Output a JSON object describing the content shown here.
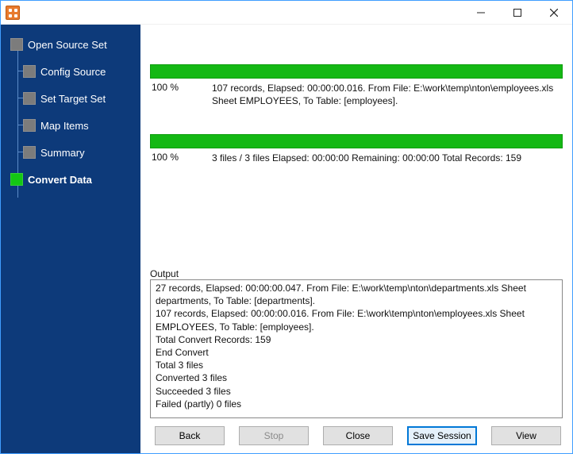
{
  "colors": {
    "sidebar_bg": "#0D3A7A",
    "accent": "#0078D7",
    "progress_green": "#14B814"
  },
  "sidebar": {
    "items": [
      {
        "label": "Open Source Set"
      },
      {
        "label": "Config Source"
      },
      {
        "label": "Set Target Set"
      },
      {
        "label": "Map Items"
      },
      {
        "label": "Summary"
      },
      {
        "label": "Convert Data"
      }
    ],
    "active_index": 5
  },
  "progress_file": {
    "percent_text": "100 %",
    "detail_text": "107 records,    Elapsed: 00:00:00.016.    From File: E:\\work\\temp\\nton\\employees.xls Sheet EMPLOYEES,    To Table: [employees]."
  },
  "progress_total": {
    "percent_text": "100 %",
    "detail_text": "3 files / 3 files    Elapsed: 00:00:00    Remaining: 00:00:00    Total Records: 159"
  },
  "output": {
    "label": "Output",
    "lines": [
      "27 records,    Elapsed: 00:00:00.047.    From File: E:\\work\\temp\\nton\\departments.xls Sheet departments,    To Table: [departments].",
      "107 records,    Elapsed: 00:00:00.016.    From File: E:\\work\\temp\\nton\\employees.xls Sheet EMPLOYEES,    To Table: [employees].",
      "Total Convert Records: 159",
      "End Convert",
      "Total 3 files",
      "Converted 3 files",
      "Succeeded 3 files",
      "Failed (partly) 0 files"
    ]
  },
  "buttons": {
    "back": "Back",
    "stop": "Stop",
    "close": "Close",
    "save_session": "Save Session",
    "view": "View"
  }
}
